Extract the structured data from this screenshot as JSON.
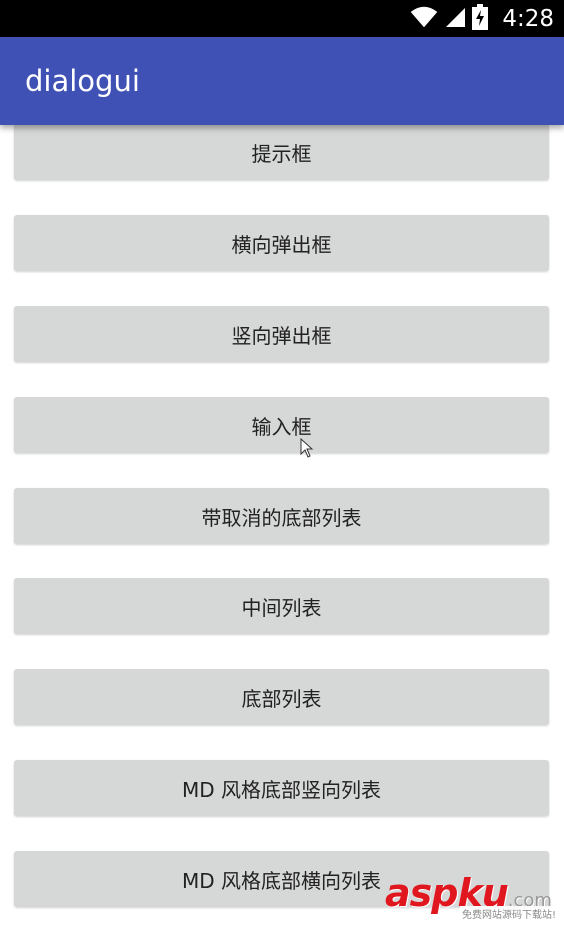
{
  "status_bar": {
    "time": "4:28",
    "icons": [
      "wifi-icon",
      "signal-icon",
      "battery-charging-icon"
    ]
  },
  "app_bar": {
    "title": "dialogui",
    "color": "#3F51B5"
  },
  "buttons": [
    {
      "label": "提示框"
    },
    {
      "label": "横向弹出框"
    },
    {
      "label": "竖向弹出框"
    },
    {
      "label": "输入框"
    },
    {
      "label": "带取消的底部列表"
    },
    {
      "label": "中间列表"
    },
    {
      "label": "底部列表"
    },
    {
      "label": "MD 风格底部竖向列表"
    },
    {
      "label": "MD 风格底部横向列表"
    }
  ],
  "watermark": {
    "brand_left": "asp",
    "brand_right": "ku",
    "domain": ".com",
    "tagline": "免费网站源码下载站!"
  }
}
